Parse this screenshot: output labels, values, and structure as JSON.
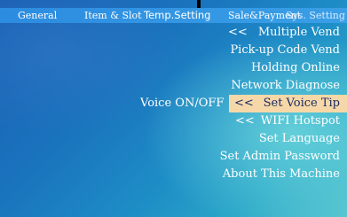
{
  "tabs": [
    {
      "label": "General"
    },
    {
      "label": "Item & Slot"
    },
    {
      "label": "Temp.Setting"
    },
    {
      "label": "Sale&Payment"
    },
    {
      "label": "Sys. Setting"
    }
  ],
  "active_tab": "Sys. Setting",
  "menu": {
    "items": [
      {
        "label": "Multiple Vend",
        "arrow": "<<"
      },
      {
        "label": "Pick-up Code Vend"
      },
      {
        "label": "Holding Online"
      },
      {
        "label": "Network Diagnose"
      },
      {
        "label": "Set Voice Tip",
        "arrow": "<<"
      },
      {
        "label": "WIFI Hotspot",
        "arrow": "<<"
      },
      {
        "label": "Set Language"
      },
      {
        "label": "Set Admin Password"
      },
      {
        "label": "About This Machine"
      }
    ],
    "selected_index": 4
  },
  "submenu_label": "Voice  ON/OFF",
  "colors": {
    "topbar": "#2c8ce0",
    "selected_bg": "#f6d8a8",
    "selected_text": "#1a2a66",
    "background": "#1a73bd"
  }
}
